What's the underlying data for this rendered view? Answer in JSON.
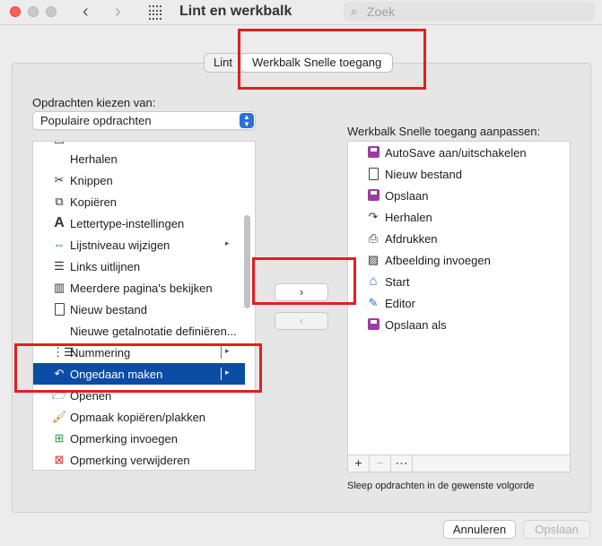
{
  "window": {
    "title": "Lint en werkbalk",
    "search_placeholder": "Zoek"
  },
  "tabs": [
    {
      "label": "Lint"
    },
    {
      "label": "Werkbalk Snelle toegang",
      "active": true
    }
  ],
  "left": {
    "choose_label": "Opdrachten kiezen van:",
    "dropdown_value": "Populaire opdrachten",
    "items": [
      {
        "label": "",
        "icon": "page-setup-icon"
      },
      {
        "label": "Herhalen",
        "icon": ""
      },
      {
        "label": "Knippen",
        "icon": "scissors-icon"
      },
      {
        "label": "Kopiëren",
        "icon": "copy-icon"
      },
      {
        "label": "Lettertype-instellingen",
        "icon": "font-A-icon"
      },
      {
        "label": "Lijstniveau wijzigen",
        "icon": "list-level-icon",
        "submenu": true
      },
      {
        "label": "Links uitlijnen",
        "icon": "align-left-icon"
      },
      {
        "label": "Meerdere pagina's bekijken",
        "icon": "multi-page-icon"
      },
      {
        "label": "Nieuw bestand",
        "icon": "new-document-icon"
      },
      {
        "label": "Nieuwe getalnotatie definiëren...",
        "icon": ""
      },
      {
        "label": "Nummering",
        "icon": "numbering-icon",
        "submenu": true
      },
      {
        "label": "Ongedaan maken",
        "icon": "undo-icon",
        "submenu": true,
        "selected": true
      },
      {
        "label": "Openen",
        "icon": "folder-icon"
      },
      {
        "label": "Opmaak kopiëren/plakken",
        "icon": "format-painter-icon"
      },
      {
        "label": "Opmerking invoegen",
        "icon": "add-comment-icon"
      },
      {
        "label": "Opmerking verwijderen",
        "icon": "delete-comment-icon"
      }
    ]
  },
  "move_buttons": {
    "add": "›",
    "remove": "‹"
  },
  "right": {
    "title": "Werkbalk Snelle toegang aanpassen:",
    "items": [
      {
        "label": "AutoSave aan/uitschakelen",
        "icon": "autosave-icon"
      },
      {
        "label": "Nieuw bestand",
        "icon": "new-document-icon"
      },
      {
        "label": "Opslaan",
        "icon": "save-icon"
      },
      {
        "label": "Herhalen",
        "icon": "redo-icon"
      },
      {
        "label": "Afdrukken",
        "icon": "print-icon"
      },
      {
        "label": "Afbeelding invoegen",
        "icon": "insert-picture-icon"
      },
      {
        "label": "Start",
        "icon": "home-icon"
      },
      {
        "label": "Editor",
        "icon": "editor-pen-icon"
      },
      {
        "label": "Opslaan als",
        "icon": "save-as-icon"
      }
    ],
    "toolbar": {
      "add": "+",
      "remove": "−",
      "more": "⋯"
    },
    "hint": "Sleep opdrachten in de gewenste volgorde"
  },
  "footer": {
    "cancel": "Annuleren",
    "save": "Opslaan"
  },
  "colors": {
    "selection": "#0b4ca4",
    "highlight_box": "#e0201f",
    "save_icon": "#9b3c9e"
  }
}
